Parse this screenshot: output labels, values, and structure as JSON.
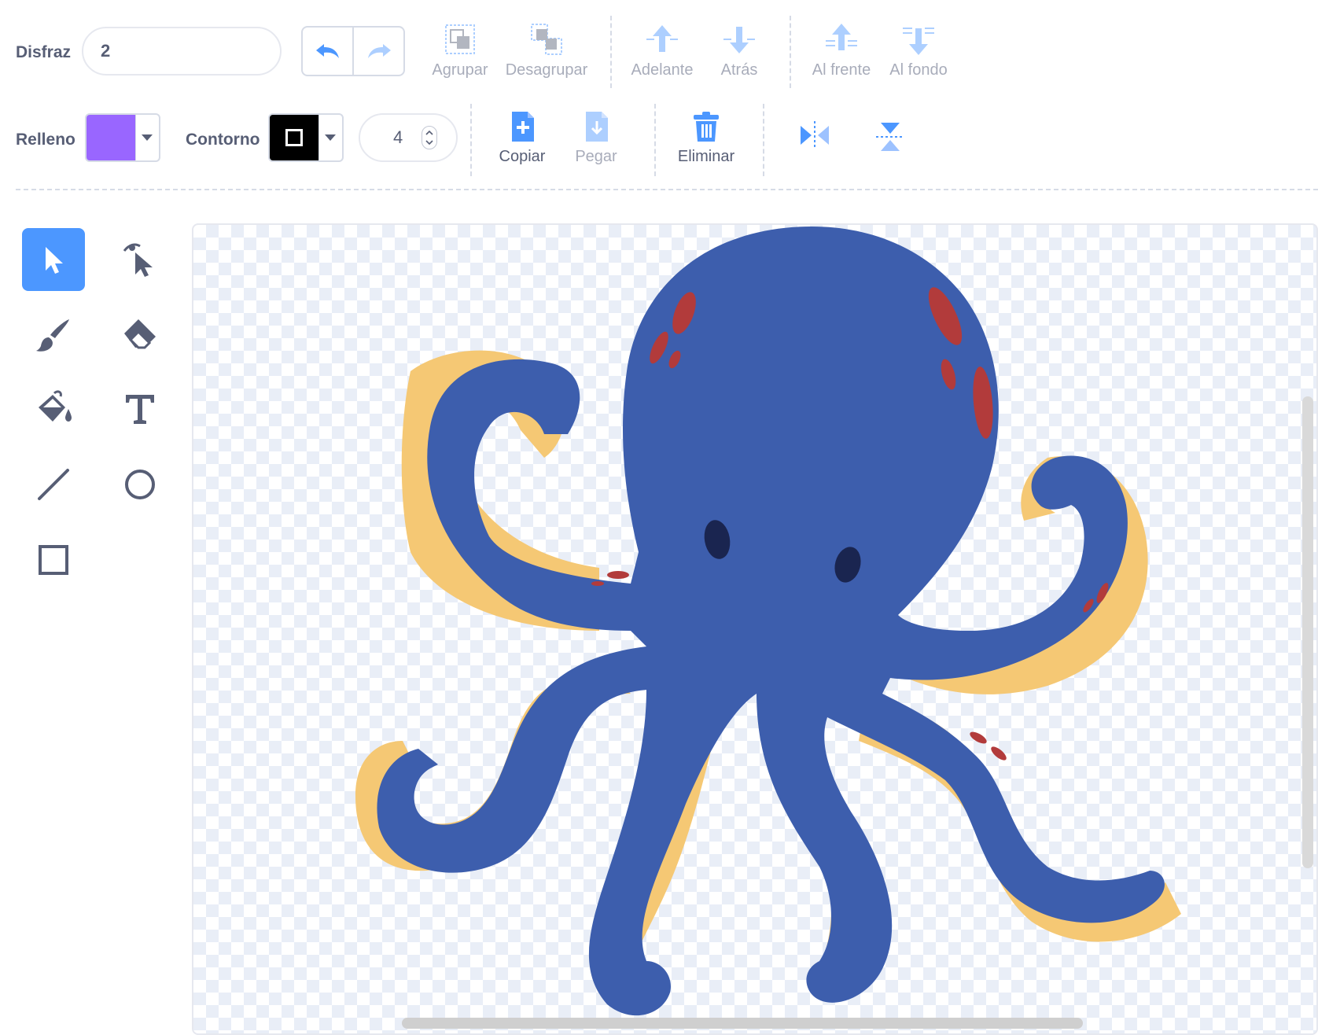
{
  "costume": {
    "label": "Disfraz",
    "name": "2"
  },
  "history": {
    "undo_icon": "undo-icon",
    "redo_icon": "redo-icon"
  },
  "arrange": {
    "group": "Agrupar",
    "ungroup": "Desagrupar",
    "forward": "Adelante",
    "backward": "Atrás",
    "front": "Al frente",
    "back": "Al fondo"
  },
  "fill": {
    "label": "Relleno",
    "color": "#9966ff"
  },
  "outline": {
    "label": "Contorno",
    "color": "#000000",
    "width": "4"
  },
  "edit": {
    "copy": "Copiar",
    "paste": "Pegar",
    "delete": "Eliminar"
  },
  "flip": {
    "horizontal_icon": "flip-horizontal-icon",
    "vertical_icon": "flip-vertical-icon"
  },
  "tools": [
    {
      "name": "select-tool",
      "icon": "arrow-cursor-icon",
      "active": true
    },
    {
      "name": "reshape-tool",
      "icon": "reshape-cursor-icon",
      "active": false
    },
    {
      "name": "brush-tool",
      "icon": "brush-icon",
      "active": false
    },
    {
      "name": "eraser-tool",
      "icon": "eraser-icon",
      "active": false
    },
    {
      "name": "fill-tool",
      "icon": "paint-bucket-icon",
      "active": false
    },
    {
      "name": "text-tool",
      "icon": "text-icon",
      "active": false
    },
    {
      "name": "line-tool",
      "icon": "line-icon",
      "active": false
    },
    {
      "name": "circle-tool",
      "icon": "circle-icon",
      "active": false
    },
    {
      "name": "rectangle-tool",
      "icon": "rectangle-icon",
      "active": false
    }
  ],
  "colors": {
    "accent": "#4c97ff",
    "octopus_body": "#3d5ead",
    "octopus_underside": "#f5c874",
    "octopus_spots": "#b23b3b",
    "octopus_eyes": "#1a2550"
  }
}
